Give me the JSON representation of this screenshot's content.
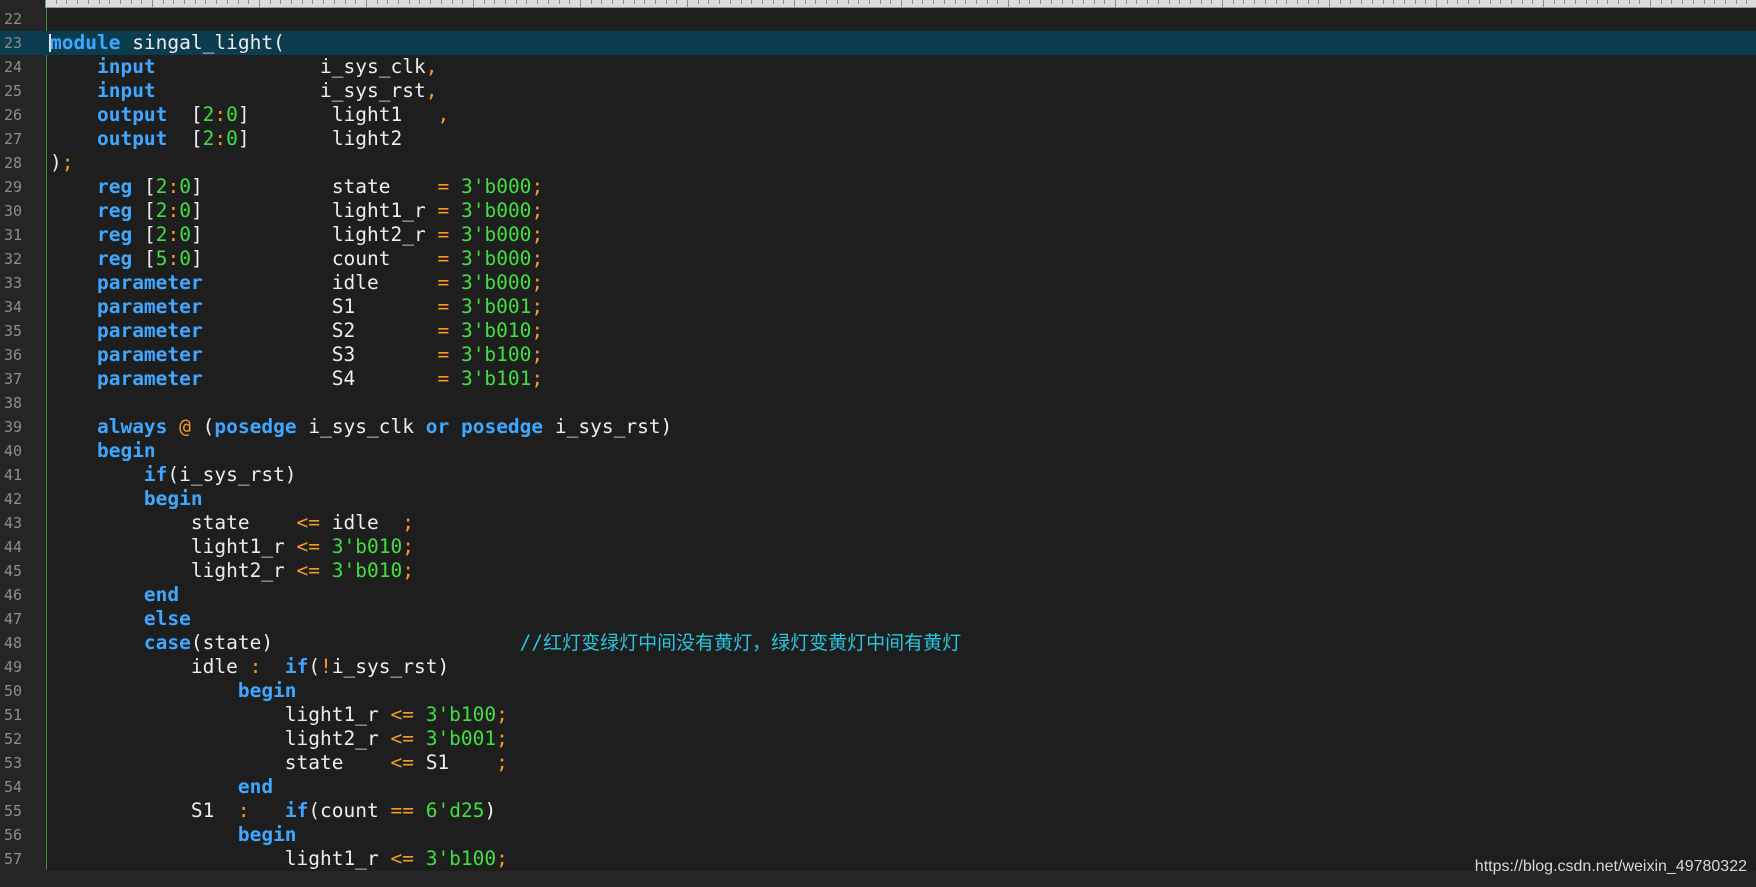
{
  "editor": {
    "language": "verilog",
    "current_line": 23,
    "lines": [
      {
        "num": "22",
        "tokens": []
      },
      {
        "num": "23",
        "tokens": [
          [
            "k",
            "module"
          ],
          [
            "w",
            " singal_light("
          ]
        ]
      },
      {
        "num": "24",
        "tokens": [
          [
            "w",
            "    "
          ],
          [
            "k",
            "input"
          ],
          [
            "w",
            "              i_sys_clk"
          ],
          [
            "o",
            ","
          ]
        ]
      },
      {
        "num": "25",
        "tokens": [
          [
            "w",
            "    "
          ],
          [
            "k",
            "input"
          ],
          [
            "w",
            "              i_sys_rst"
          ],
          [
            "o",
            ","
          ]
        ]
      },
      {
        "num": "26",
        "tokens": [
          [
            "w",
            "    "
          ],
          [
            "k",
            "output"
          ],
          [
            "w",
            "  ["
          ],
          [
            "n",
            "2"
          ],
          [
            "o",
            ":"
          ],
          [
            "n",
            "0"
          ],
          [
            "w",
            "]       light1   "
          ],
          [
            "o",
            ","
          ]
        ]
      },
      {
        "num": "27",
        "tokens": [
          [
            "w",
            "    "
          ],
          [
            "k",
            "output"
          ],
          [
            "w",
            "  ["
          ],
          [
            "n",
            "2"
          ],
          [
            "o",
            ":"
          ],
          [
            "n",
            "0"
          ],
          [
            "w",
            "]       light2"
          ]
        ]
      },
      {
        "num": "28",
        "tokens": [
          [
            "w",
            ")"
          ],
          [
            "o",
            ";"
          ]
        ]
      },
      {
        "num": "29",
        "tokens": [
          [
            "w",
            "    "
          ],
          [
            "k",
            "reg"
          ],
          [
            "w",
            " ["
          ],
          [
            "n",
            "2"
          ],
          [
            "o",
            ":"
          ],
          [
            "n",
            "0"
          ],
          [
            "w",
            "]           state    "
          ],
          [
            "o",
            "="
          ],
          [
            "w",
            " "
          ],
          [
            "n",
            "3'b000"
          ],
          [
            "o",
            ";"
          ]
        ]
      },
      {
        "num": "30",
        "tokens": [
          [
            "w",
            "    "
          ],
          [
            "k",
            "reg"
          ],
          [
            "w",
            " ["
          ],
          [
            "n",
            "2"
          ],
          [
            "o",
            ":"
          ],
          [
            "n",
            "0"
          ],
          [
            "w",
            "]           light1_r "
          ],
          [
            "o",
            "="
          ],
          [
            "w",
            " "
          ],
          [
            "n",
            "3'b000"
          ],
          [
            "o",
            ";"
          ]
        ]
      },
      {
        "num": "31",
        "tokens": [
          [
            "w",
            "    "
          ],
          [
            "k",
            "reg"
          ],
          [
            "w",
            " ["
          ],
          [
            "n",
            "2"
          ],
          [
            "o",
            ":"
          ],
          [
            "n",
            "0"
          ],
          [
            "w",
            "]           light2_r "
          ],
          [
            "o",
            "="
          ],
          [
            "w",
            " "
          ],
          [
            "n",
            "3'b000"
          ],
          [
            "o",
            ";"
          ]
        ]
      },
      {
        "num": "32",
        "tokens": [
          [
            "w",
            "    "
          ],
          [
            "k",
            "reg"
          ],
          [
            "w",
            " ["
          ],
          [
            "n",
            "5"
          ],
          [
            "o",
            ":"
          ],
          [
            "n",
            "0"
          ],
          [
            "w",
            "]           count    "
          ],
          [
            "o",
            "="
          ],
          [
            "w",
            " "
          ],
          [
            "n",
            "3'b000"
          ],
          [
            "o",
            ";"
          ]
        ]
      },
      {
        "num": "33",
        "tokens": [
          [
            "w",
            "    "
          ],
          [
            "k",
            "parameter"
          ],
          [
            "w",
            "           idle     "
          ],
          [
            "o",
            "="
          ],
          [
            "w",
            " "
          ],
          [
            "n",
            "3'b000"
          ],
          [
            "o",
            ";"
          ]
        ]
      },
      {
        "num": "34",
        "tokens": [
          [
            "w",
            "    "
          ],
          [
            "k",
            "parameter"
          ],
          [
            "w",
            "           S1       "
          ],
          [
            "o",
            "="
          ],
          [
            "w",
            " "
          ],
          [
            "n",
            "3'b001"
          ],
          [
            "o",
            ";"
          ]
        ]
      },
      {
        "num": "35",
        "tokens": [
          [
            "w",
            "    "
          ],
          [
            "k",
            "parameter"
          ],
          [
            "w",
            "           S2       "
          ],
          [
            "o",
            "="
          ],
          [
            "w",
            " "
          ],
          [
            "n",
            "3'b010"
          ],
          [
            "o",
            ";"
          ]
        ]
      },
      {
        "num": "36",
        "tokens": [
          [
            "w",
            "    "
          ],
          [
            "k",
            "parameter"
          ],
          [
            "w",
            "           S3       "
          ],
          [
            "o",
            "="
          ],
          [
            "w",
            " "
          ],
          [
            "n",
            "3'b100"
          ],
          [
            "o",
            ";"
          ]
        ]
      },
      {
        "num": "37",
        "tokens": [
          [
            "w",
            "    "
          ],
          [
            "k",
            "parameter"
          ],
          [
            "w",
            "           S4       "
          ],
          [
            "o",
            "="
          ],
          [
            "w",
            " "
          ],
          [
            "n",
            "3'b101"
          ],
          [
            "o",
            ";"
          ]
        ]
      },
      {
        "num": "38",
        "tokens": []
      },
      {
        "num": "39",
        "tokens": [
          [
            "w",
            "    "
          ],
          [
            "k",
            "always"
          ],
          [
            "w",
            " "
          ],
          [
            "o",
            "@"
          ],
          [
            "w",
            " ("
          ],
          [
            "k",
            "posedge"
          ],
          [
            "w",
            " i_sys_clk "
          ],
          [
            "k",
            "or"
          ],
          [
            "w",
            " "
          ],
          [
            "k",
            "posedge"
          ],
          [
            "w",
            " i_sys_rst)"
          ]
        ]
      },
      {
        "num": "40",
        "tokens": [
          [
            "w",
            "    "
          ],
          [
            "k",
            "begin"
          ]
        ]
      },
      {
        "num": "41",
        "tokens": [
          [
            "w",
            "        "
          ],
          [
            "k",
            "if"
          ],
          [
            "w",
            "(i_sys_rst)"
          ]
        ]
      },
      {
        "num": "42",
        "tokens": [
          [
            "w",
            "        "
          ],
          [
            "k",
            "begin"
          ]
        ]
      },
      {
        "num": "43",
        "tokens": [
          [
            "w",
            "            state    "
          ],
          [
            "o",
            "<="
          ],
          [
            "w",
            " idle  "
          ],
          [
            "o",
            ";"
          ]
        ]
      },
      {
        "num": "44",
        "tokens": [
          [
            "w",
            "            light1_r "
          ],
          [
            "o",
            "<="
          ],
          [
            "w",
            " "
          ],
          [
            "n",
            "3'b010"
          ],
          [
            "o",
            ";"
          ]
        ]
      },
      {
        "num": "45",
        "tokens": [
          [
            "w",
            "            light2_r "
          ],
          [
            "o",
            "<="
          ],
          [
            "w",
            " "
          ],
          [
            "n",
            "3'b010"
          ],
          [
            "o",
            ";"
          ]
        ]
      },
      {
        "num": "46",
        "tokens": [
          [
            "w",
            "        "
          ],
          [
            "k",
            "end"
          ]
        ]
      },
      {
        "num": "47",
        "tokens": [
          [
            "w",
            "        "
          ],
          [
            "k",
            "else"
          ]
        ]
      },
      {
        "num": "48",
        "tokens": [
          [
            "w",
            "        "
          ],
          [
            "k",
            "case"
          ],
          [
            "w",
            "(state)                     "
          ],
          [
            "c",
            "//"
          ],
          [
            "cc",
            "红灯变绿灯中间没有黄灯，绿灯变黄灯中间有黄灯"
          ]
        ]
      },
      {
        "num": "49",
        "tokens": [
          [
            "w",
            "            idle "
          ],
          [
            "o",
            ":"
          ],
          [
            "w",
            "  "
          ],
          [
            "k",
            "if"
          ],
          [
            "w",
            "("
          ],
          [
            "o",
            "!"
          ],
          [
            "w",
            "i_sys_rst)"
          ]
        ]
      },
      {
        "num": "50",
        "tokens": [
          [
            "w",
            "                "
          ],
          [
            "k",
            "begin"
          ]
        ]
      },
      {
        "num": "51",
        "tokens": [
          [
            "w",
            "                    light1_r "
          ],
          [
            "o",
            "<="
          ],
          [
            "w",
            " "
          ],
          [
            "n",
            "3'b100"
          ],
          [
            "o",
            ";"
          ]
        ]
      },
      {
        "num": "52",
        "tokens": [
          [
            "w",
            "                    light2_r "
          ],
          [
            "o",
            "<="
          ],
          [
            "w",
            " "
          ],
          [
            "n",
            "3'b001"
          ],
          [
            "o",
            ";"
          ]
        ]
      },
      {
        "num": "53",
        "tokens": [
          [
            "w",
            "                    state    "
          ],
          [
            "o",
            "<="
          ],
          [
            "w",
            " S1    "
          ],
          [
            "o",
            ";"
          ]
        ]
      },
      {
        "num": "54",
        "tokens": [
          [
            "w",
            "                "
          ],
          [
            "k",
            "end"
          ]
        ]
      },
      {
        "num": "55",
        "tokens": [
          [
            "w",
            "            S1  "
          ],
          [
            "o",
            ":"
          ],
          [
            "w",
            "   "
          ],
          [
            "k",
            "if"
          ],
          [
            "w",
            "(count "
          ],
          [
            "o",
            "=="
          ],
          [
            "w",
            " "
          ],
          [
            "n",
            "6'd25"
          ],
          [
            "w",
            ")"
          ]
        ]
      },
      {
        "num": "56",
        "tokens": [
          [
            "w",
            "                "
          ],
          [
            "k",
            "begin"
          ]
        ]
      },
      {
        "num": "57",
        "tokens": [
          [
            "w",
            "                    light1_r "
          ],
          [
            "o",
            "<="
          ],
          [
            "w",
            " "
          ],
          [
            "n",
            "3'b100"
          ],
          [
            "o",
            ";"
          ]
        ]
      }
    ]
  },
  "watermark": "https://blog.csdn.net/weixin_49780322",
  "colors": {
    "background": "#1e1e1e",
    "current_line": "#0c3c50",
    "keyword": "#3fa7ff",
    "operator": "#f59a26",
    "number": "#3fe03f",
    "comment": "#27c5df"
  }
}
